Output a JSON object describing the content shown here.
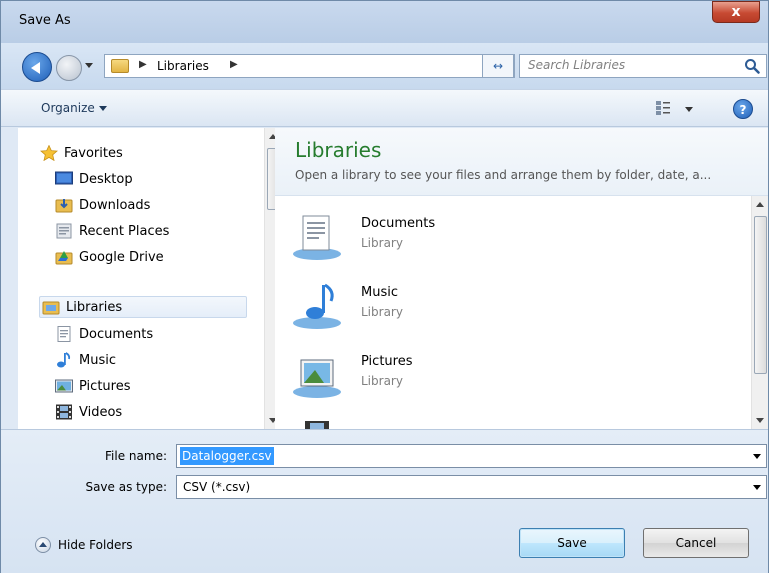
{
  "window": {
    "title": "Save As",
    "close_label": "x"
  },
  "address": {
    "path_label": "Libraries",
    "refresh_label": "↔",
    "search_placeholder": "Search Libraries"
  },
  "toolbar": {
    "organize_label": "Organize",
    "help_label": "?"
  },
  "navpane": {
    "favorites": {
      "label": "Favorites",
      "items": [
        "Desktop",
        "Downloads",
        "Recent Places",
        "Google Drive"
      ]
    },
    "libraries": {
      "label": "Libraries",
      "items": [
        "Documents",
        "Music",
        "Pictures",
        "Videos"
      ]
    }
  },
  "content": {
    "title": "Libraries",
    "description": "Open a library to see your files and arrange them by folder, date, a...",
    "items": [
      {
        "name": "Documents",
        "type": "Library"
      },
      {
        "name": "Music",
        "type": "Library"
      },
      {
        "name": "Pictures",
        "type": "Library"
      }
    ]
  },
  "form": {
    "filename_label": "File name:",
    "filename_value": "Datalogger.csv",
    "type_label": "Save as type:",
    "type_value": "CSV (*.csv)"
  },
  "footer": {
    "hide_folders_label": "Hide Folders",
    "save_label": "Save",
    "cancel_label": "Cancel"
  },
  "colors": {
    "accent_green": "#267c2e",
    "selection_blue": "#3399ff",
    "close_red": "#c74a33"
  }
}
